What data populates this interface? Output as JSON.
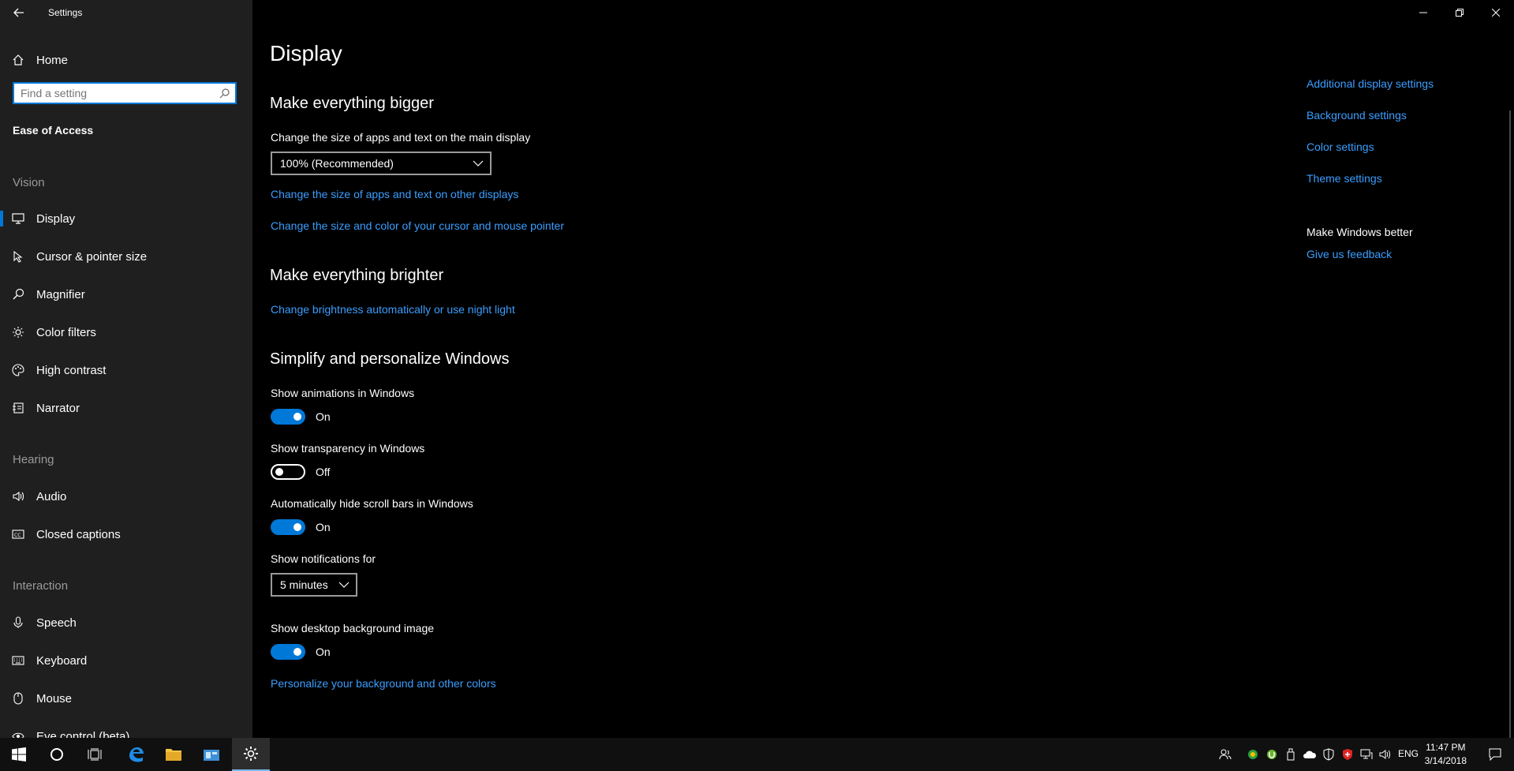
{
  "window": {
    "title": "Settings",
    "controls": {
      "minimize": "minimize-icon",
      "restore": "restore-icon",
      "close": "close-icon"
    }
  },
  "sidebar": {
    "home_label": "Home",
    "search_placeholder": "Find a setting",
    "category": "Ease of Access",
    "sections": [
      {
        "heading": "Vision",
        "items": [
          {
            "label": "Display",
            "icon": "monitor-icon",
            "active": true
          },
          {
            "label": "Cursor & pointer size",
            "icon": "cursor-icon"
          },
          {
            "label": "Magnifier",
            "icon": "magnifier-icon"
          },
          {
            "label": "Color filters",
            "icon": "sun-icon"
          },
          {
            "label": "High contrast",
            "icon": "palette-icon"
          },
          {
            "label": "Narrator",
            "icon": "narrator-icon"
          }
        ]
      },
      {
        "heading": "Hearing",
        "items": [
          {
            "label": "Audio",
            "icon": "speaker-icon"
          },
          {
            "label": "Closed captions",
            "icon": "captions-icon"
          }
        ]
      },
      {
        "heading": "Interaction",
        "items": [
          {
            "label": "Speech",
            "icon": "microphone-icon"
          },
          {
            "label": "Keyboard",
            "icon": "keyboard-icon"
          },
          {
            "label": "Mouse",
            "icon": "mouse-icon"
          },
          {
            "label": "Eye control (beta)",
            "icon": "eye-icon"
          }
        ]
      }
    ]
  },
  "main": {
    "title": "Display",
    "bigger": {
      "heading": "Make everything bigger",
      "scale_label": "Change the size of apps and text on the main display",
      "scale_value": "100% (Recommended)",
      "link_other_displays": "Change the size of apps and text on other displays",
      "link_cursor": "Change the size and color of your cursor and mouse pointer"
    },
    "brighter": {
      "heading": "Make everything brighter",
      "link_brightness": "Change brightness automatically or use night light"
    },
    "simplify": {
      "heading": "Simplify and personalize Windows",
      "animations_label": "Show animations in Windows",
      "animations_state": "On",
      "transparency_label": "Show transparency in Windows",
      "transparency_state": "Off",
      "scrollbars_label": "Automatically hide scroll bars in Windows",
      "scrollbars_state": "On",
      "notifications_label": "Show notifications for",
      "notifications_value": "5 minutes",
      "background_label": "Show desktop background image",
      "background_state": "On",
      "link_personalize": "Personalize your background and other colors"
    },
    "related": {
      "links": [
        "Additional display settings",
        "Background settings",
        "Color settings",
        "Theme settings"
      ],
      "feedback_heading": "Make Windows better",
      "feedback_link": "Give us feedback"
    }
  },
  "taskbar": {
    "apps": [
      "windows-start-icon",
      "cortana-icon",
      "task-view-icon",
      "edge-icon",
      "file-explorer-icon",
      "store-icon",
      "settings-icon"
    ],
    "language": "ENG",
    "time": "11:47 PM",
    "date": "3/14/2018"
  },
  "colors": {
    "accent": "#0078d7",
    "link": "#3a9eff",
    "sidebar_bg": "#1f1f1f",
    "main_bg": "#000000"
  }
}
